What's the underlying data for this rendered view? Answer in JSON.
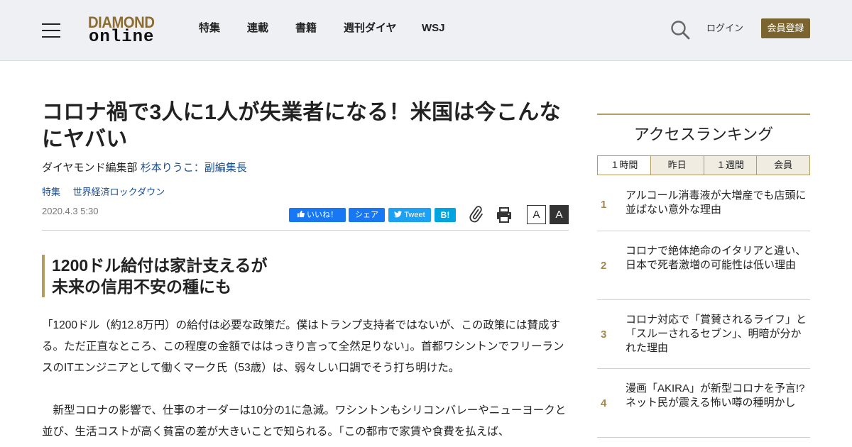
{
  "header": {
    "logo_top": "DIAMOND",
    "logo_bottom": "online",
    "nav": [
      "特集",
      "連載",
      "書籍",
      "週刊ダイヤ",
      "WSJ"
    ],
    "login_label": "ログイン",
    "register_label": "会員登録"
  },
  "article": {
    "title": "コロナ禍で3人に1人が失業者になる！米国は今こんなにヤバい",
    "byline_prefix": "ダイヤモンド編集部",
    "author": "杉本りうこ：副編集長",
    "tags": [
      "特集",
      "世界経済ロックダウン"
    ],
    "date": "2020.4.3 5:30",
    "share": {
      "like": "いいね！",
      "share": "シェア",
      "tweet": "Tweet",
      "hatena": "B!"
    },
    "font_small": "A",
    "font_large": "A",
    "subhead_line1": "1200ドル給付は家計支えるが",
    "subhead_line2": "未来の信用不安の種にも",
    "para1": "「1200ドル（約12.8万円）の給付は必要な政策だ。僕はトランプ支持者ではないが、この政策には賛成する。ただ正直なところ、この程度の金額でははっきり言って全然足りない」。首都ワシントンでフリーランスのITエンジニアとして働くマーク氏（53歳）は、弱々しい口調でそう打ち明けた。",
    "para2": "　新型コロナの影響で、仕事のオーダーは10分の1に急減。ワシントンもシリコンバレーやニューヨークと並び、生活コストが高く貧富の差が大きいことで知られる。「この都市で家賃や食費を払えば、"
  },
  "sidebar": {
    "title": "アクセスランキング",
    "tabs": [
      "１時間",
      "昨日",
      "１週間",
      "会員"
    ],
    "items": [
      {
        "rank": "1",
        "text": "アルコール消毒液が大増産でも店頭に並ばない意外な理由"
      },
      {
        "rank": "2",
        "text": "コロナで絶体絶命のイタリアと違い、日本で死者激増の可能性は低い理由"
      },
      {
        "rank": "3",
        "text": "コロナ対応で「賞賛されるライフ」と「スルーされるセブン」、明暗が分かれた理由"
      },
      {
        "rank": "4",
        "text": "漫画「AKIRA」が新型コロナを予言!?ネット民が震える怖い噂の種明かし"
      }
    ]
  }
}
